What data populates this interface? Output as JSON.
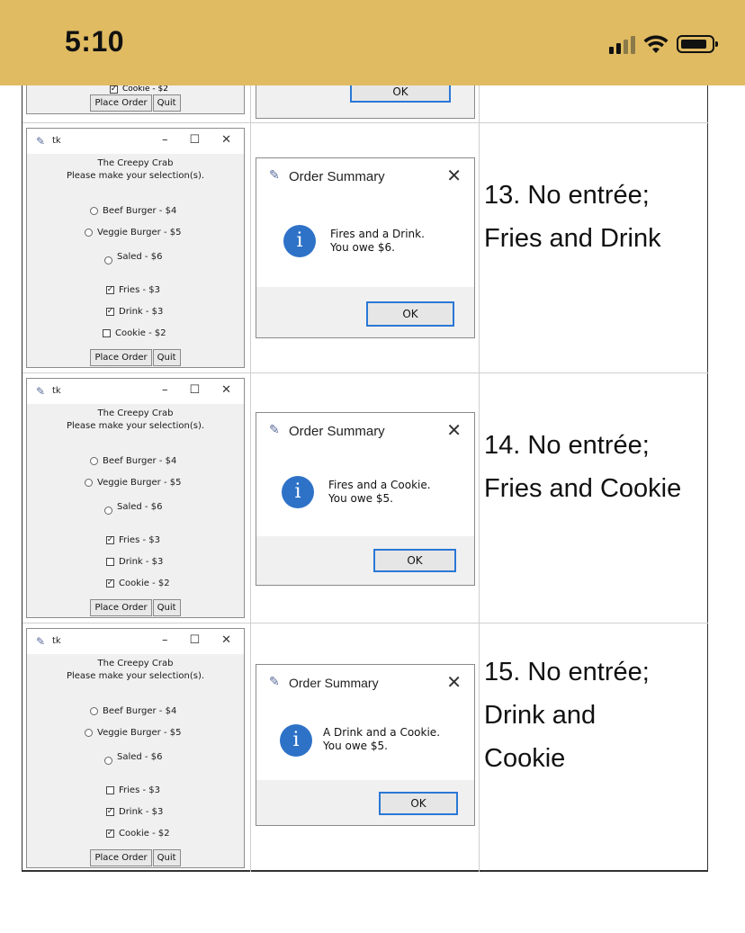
{
  "status_bar": {
    "time": "5:10",
    "signal_icon": "signal-bars-icon",
    "wifi_icon": "wifi-icon",
    "battery_icon": "battery-icon",
    "background": "#e0bb62"
  },
  "previous_row": {
    "cookie_label": "Cookie - $2",
    "place_order": "Place Order",
    "quit": "Quit",
    "ok": "OK"
  },
  "rows": [
    {
      "tk_title": "tk",
      "tk_head_line1": "The Creepy Crab",
      "tk_head_line2": "Please make your selection(s).",
      "options": {
        "beef": "Beef Burger - $4",
        "veggie": "Veggie Burger - $5",
        "salad": "Saled - $6",
        "fries": "Fries - $3",
        "drink": "Drink - $3",
        "cookie": "Cookie - $2"
      },
      "checked": {
        "fries": true,
        "drink": true,
        "cookie": false
      },
      "place_order": "Place Order",
      "quit": "Quit",
      "dialog_title": "Order Summary",
      "msg_line1": "Fires and a Drink.",
      "msg_line2": "You owe $6.",
      "ok": "OK",
      "desc_line1": "13. No entrée;",
      "desc_line2": "Fries and Drink",
      "desc_line3": ""
    },
    {
      "tk_title": "tk",
      "tk_head_line1": "The Creepy Crab",
      "tk_head_line2": "Please make your selection(s).",
      "options": {
        "beef": "Beef Burger - $4",
        "veggie": "Veggie Burger - $5",
        "salad": "Saled - $6",
        "fries": "Fries - $3",
        "drink": "Drink - $3",
        "cookie": "Cookie - $2"
      },
      "checked": {
        "fries": true,
        "drink": false,
        "cookie": true
      },
      "place_order": "Place Order",
      "quit": "Quit",
      "dialog_title": "Order Summary",
      "msg_line1": "Fires and a Cookie.",
      "msg_line2": "You owe $5.",
      "ok": "OK",
      "desc_line1": "14. No entrée;",
      "desc_line2": "Fries and Cookie",
      "desc_line3": ""
    },
    {
      "tk_title": "tk",
      "tk_head_line1": "The Creepy Crab",
      "tk_head_line2": "Please make your selection(s).",
      "options": {
        "beef": "Beef Burger - $4",
        "veggie": "Veggie Burger - $5",
        "salad": "Saled - $6",
        "fries": "Fries - $3",
        "drink": "Drink - $3",
        "cookie": "Cookie - $2"
      },
      "checked": {
        "fries": false,
        "drink": true,
        "cookie": true
      },
      "place_order": "Place Order",
      "quit": "Quit",
      "dialog_title": "Order Summary",
      "msg_line1": "A Drink and a Cookie.",
      "msg_line2": "You owe $5.",
      "ok": "OK",
      "desc_line1": "15. No entrée;",
      "desc_line2": "Drink and",
      "desc_line3": "Cookie"
    }
  ]
}
